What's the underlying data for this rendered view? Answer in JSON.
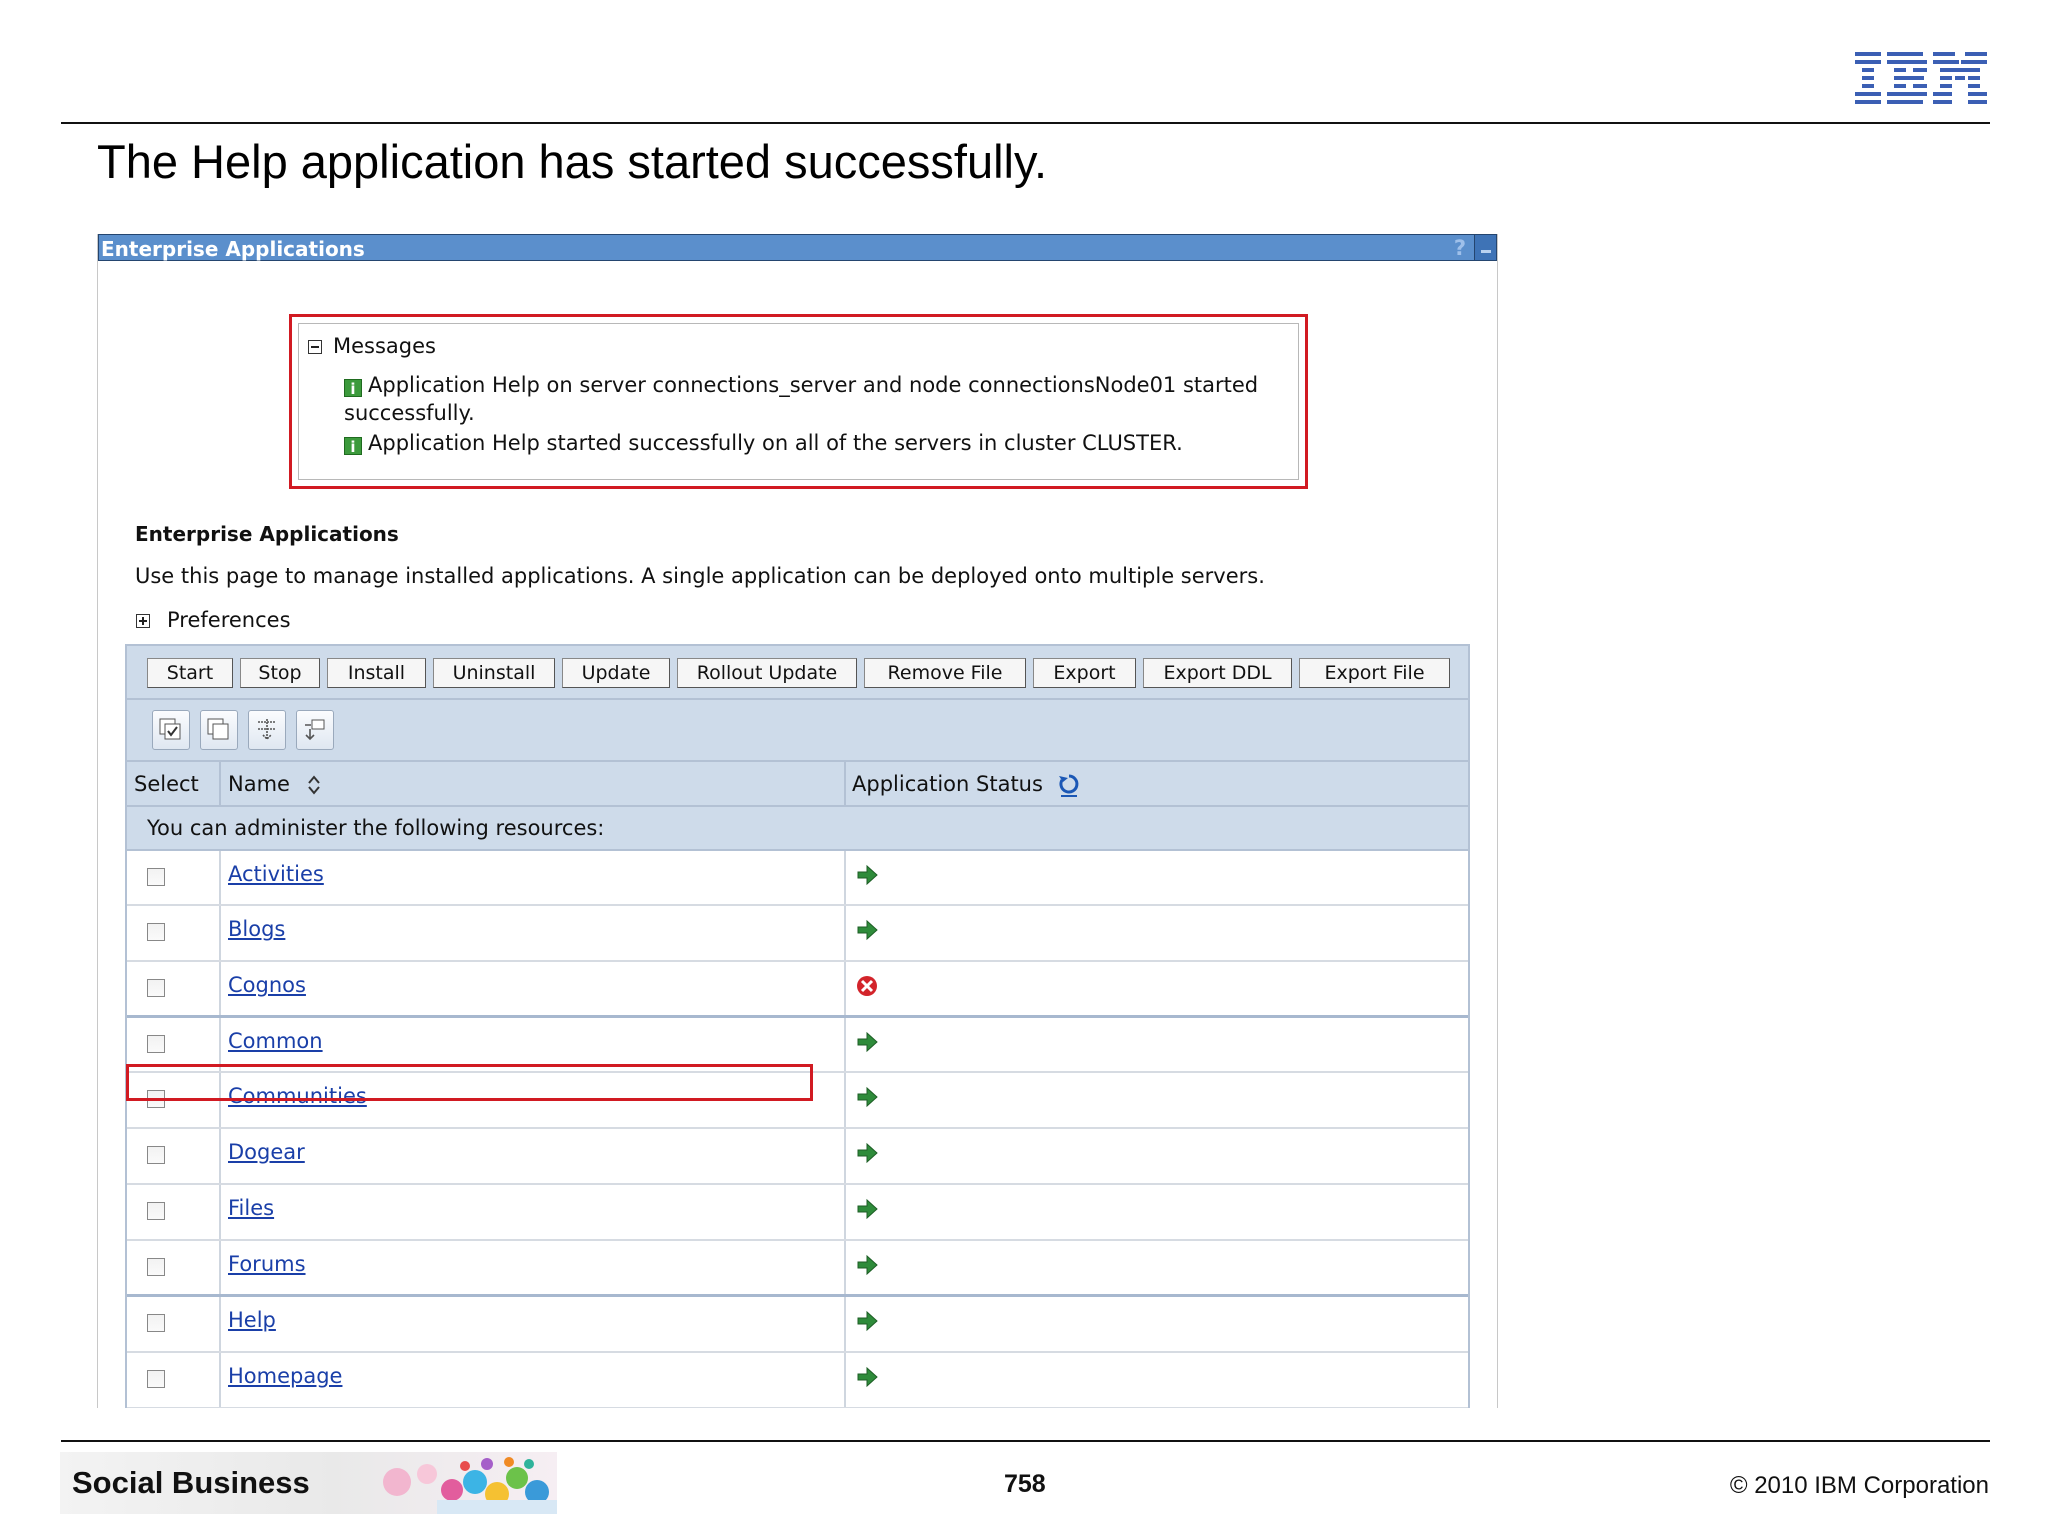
{
  "slide": {
    "title": "The Help application has started successfully.",
    "brand": "Social Business",
    "page_number": "758",
    "copyright": "© 2010 IBM Corporation",
    "logo_text": "IBM"
  },
  "panel": {
    "title": "Enterprise Applications",
    "help_glyph": "?"
  },
  "messages": {
    "label": "Messages",
    "items": [
      "Application Help on server connections_server and node connectionsNode01 started successfully.",
      "Application Help started successfully on all of the servers in cluster CLUSTER."
    ]
  },
  "section": {
    "title": "Enterprise Applications",
    "description": "Use this page to manage installed applications. A single application can be deployed onto multiple servers.",
    "preferences": "Preferences"
  },
  "toolbar": {
    "buttons": [
      "Start",
      "Stop",
      "Install",
      "Uninstall",
      "Update",
      "Rollout Update",
      "Remove File",
      "Export",
      "Export DDL",
      "Export File"
    ]
  },
  "icon_buttons": [
    "select-all-icon",
    "deselect-all-icon",
    "expand-all-icon",
    "collapse-all-icon"
  ],
  "table": {
    "headers": {
      "select": "Select",
      "name": "Name",
      "status": "Application Status"
    },
    "resources_text": "You can administer the following resources:",
    "rows": [
      {
        "name": "Activities",
        "status": "started"
      },
      {
        "name": "Blogs",
        "status": "started"
      },
      {
        "name": "Cognos",
        "status": "stopped"
      },
      {
        "name": "Common",
        "status": "started"
      },
      {
        "name": "Communities",
        "status": "started"
      },
      {
        "name": "Dogear",
        "status": "started"
      },
      {
        "name": "Files",
        "status": "started"
      },
      {
        "name": "Forums",
        "status": "started"
      },
      {
        "name": "Help",
        "status": "started"
      },
      {
        "name": "Homepage",
        "status": "started"
      }
    ]
  },
  "colors": {
    "panel_header": "#5b8fcc",
    "highlight": "#d11a22",
    "link": "#1a3fa8",
    "started_green": "#2e8b3a",
    "stopped_red": "#d3242b"
  }
}
